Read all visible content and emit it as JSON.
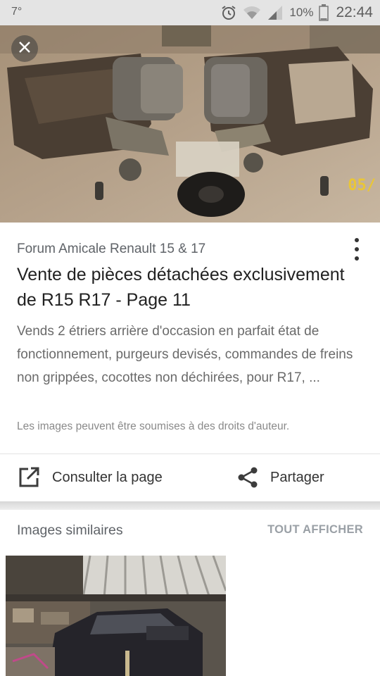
{
  "status_bar": {
    "temperature": "7°",
    "battery": "10%",
    "time": "22:44",
    "icons": [
      "alarm-icon",
      "wifi-icon",
      "signal-icon",
      "battery-icon"
    ]
  },
  "hero": {
    "stamp": "05/",
    "close_icon": "close-icon"
  },
  "result": {
    "source": "Forum Amicale Renault 15 & 17",
    "title": "Vente de pièces détachées exclusivement de R15 R17 - Page 11",
    "snippet": "Vends 2 étriers arrière d'occasion en parfait état de fonctionnement, purgeurs devisés, commandes de freins non grippées, cocottes non déchirées, pour R17, ...",
    "copyright": "Les images peuvent être soumises à des droits d'auteur."
  },
  "actions": {
    "visit_label": "Consulter la page",
    "share_label": "Partager"
  },
  "similar": {
    "title": "Images similaires",
    "show_all": "TOUT AFFICHER"
  },
  "colors": {
    "status_bg": "#e4e4e4",
    "text_primary": "#212121",
    "text_secondary": "#5f6368",
    "accent_muted": "#9aa0a6"
  }
}
